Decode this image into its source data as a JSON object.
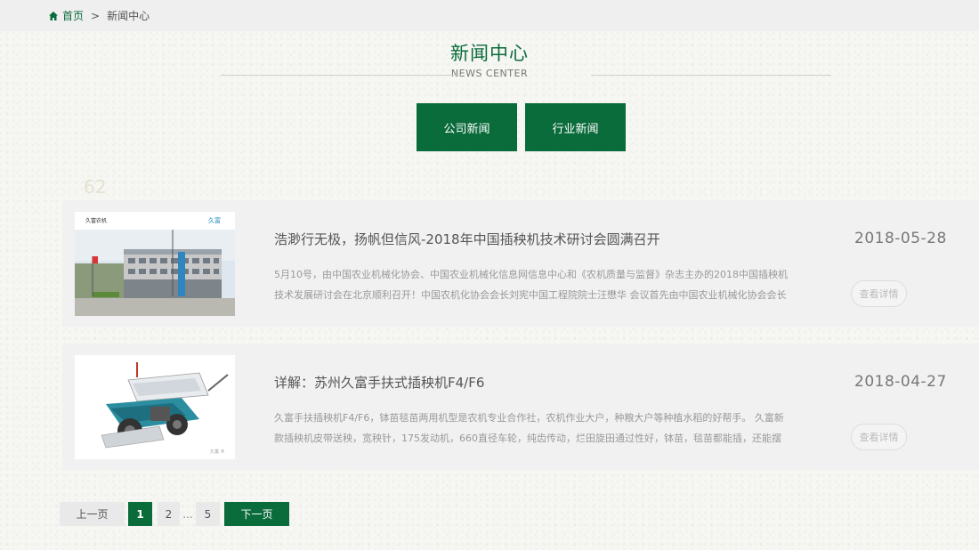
{
  "breadcrumb": {
    "home": "首页",
    "separator": ">",
    "current": "新闻中心"
  },
  "section": {
    "title": "新闻中心",
    "subtitle": "NEWS CENTER"
  },
  "categories": [
    {
      "label": "公司新闻"
    },
    {
      "label": "行业新闻"
    }
  ],
  "news": [
    {
      "title": "浩渺行无极，扬帆但信风-2018年中国插秧机技术研讨会圆满召开",
      "summary": "5月10号，由中国农业机械化协会、中国农业机械化信息网信息中心和《农机质量与监督》杂志主办的2018中国插秧机技术发展研讨会在北京顺利召开！中国农机化协会会长刘宪中国工程院院士汪懋华 会议首先由中国农业机械化协会会长刘宪",
      "date": "2018-05-28",
      "detail_label": "查看详情",
      "image_sign_left": "久富农机",
      "image_sign_right": "久富"
    },
    {
      "title": "详解：苏州久富手扶式插秧机F4/F6",
      "summary": "久富手扶插秧机F4/F6，钵苗毯苗两用机型是农机专业合作社，农机作业大户，种粮大户等种植水稻的好帮手。 久富新款插秧机皮带送秧，宽秧针，175发动机，660直径车轮，纯齿传动，烂田旋田通过性好，钵苗，毯苗都能插，还能摆栽！采",
      "date": "2018-04-27",
      "detail_label": "查看详情"
    }
  ],
  "pagination": {
    "prev": "上一页",
    "pages": [
      "1",
      "2",
      "5"
    ],
    "ellipsis": "...",
    "next": "下一页",
    "current": "1"
  },
  "colors": {
    "brand_green": "#0a6b3b",
    "card_bg": "#f1f1f1"
  }
}
